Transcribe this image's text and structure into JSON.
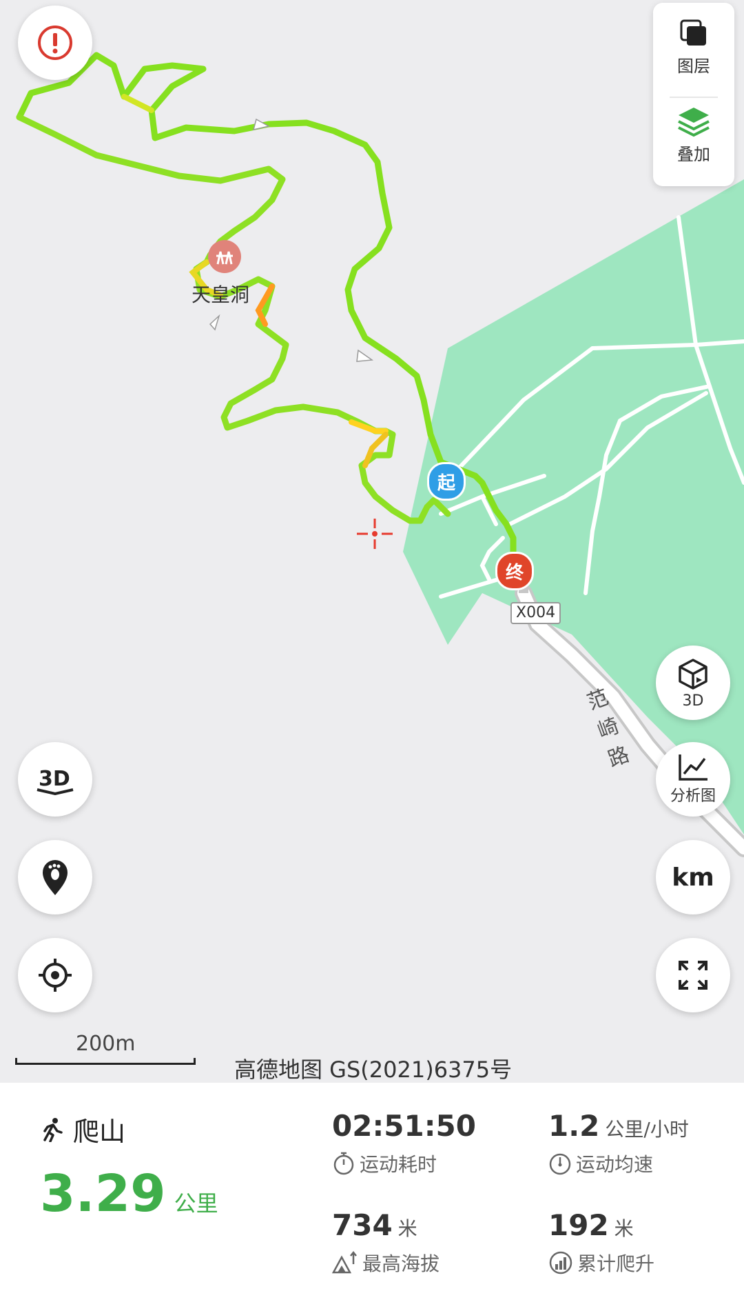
{
  "map": {
    "poi_label": "天皇洞",
    "start_label": "起",
    "end_label": "终",
    "road_badge": "X004",
    "road_name": "范崎路",
    "scale_label": "200m",
    "copyright": "高德地图 GS(2021)6375号",
    "colors": {
      "route": "#7ee022",
      "park": "#9ee6c0",
      "start": "#2f9ee6",
      "end": "#e0452a",
      "poi": "#e0837a"
    }
  },
  "controls": {
    "layers_label": "图层",
    "overlay_label": "叠加",
    "view3d_label": "3D",
    "analysis_label": "分析图",
    "unit_label": "km"
  },
  "summary": {
    "sport_type": "爬山",
    "distance": "3.29",
    "distance_unit": "公里",
    "duration": "02:51:50",
    "duration_label": "运动耗时",
    "avg_speed": "1.2",
    "avg_speed_unit": "公里/小时",
    "avg_speed_label": "运动均速",
    "max_altitude": "734",
    "max_altitude_unit": "米",
    "max_altitude_label": "最高海拔",
    "total_climb": "192",
    "total_climb_unit": "米",
    "total_climb_label": "累计爬升"
  }
}
